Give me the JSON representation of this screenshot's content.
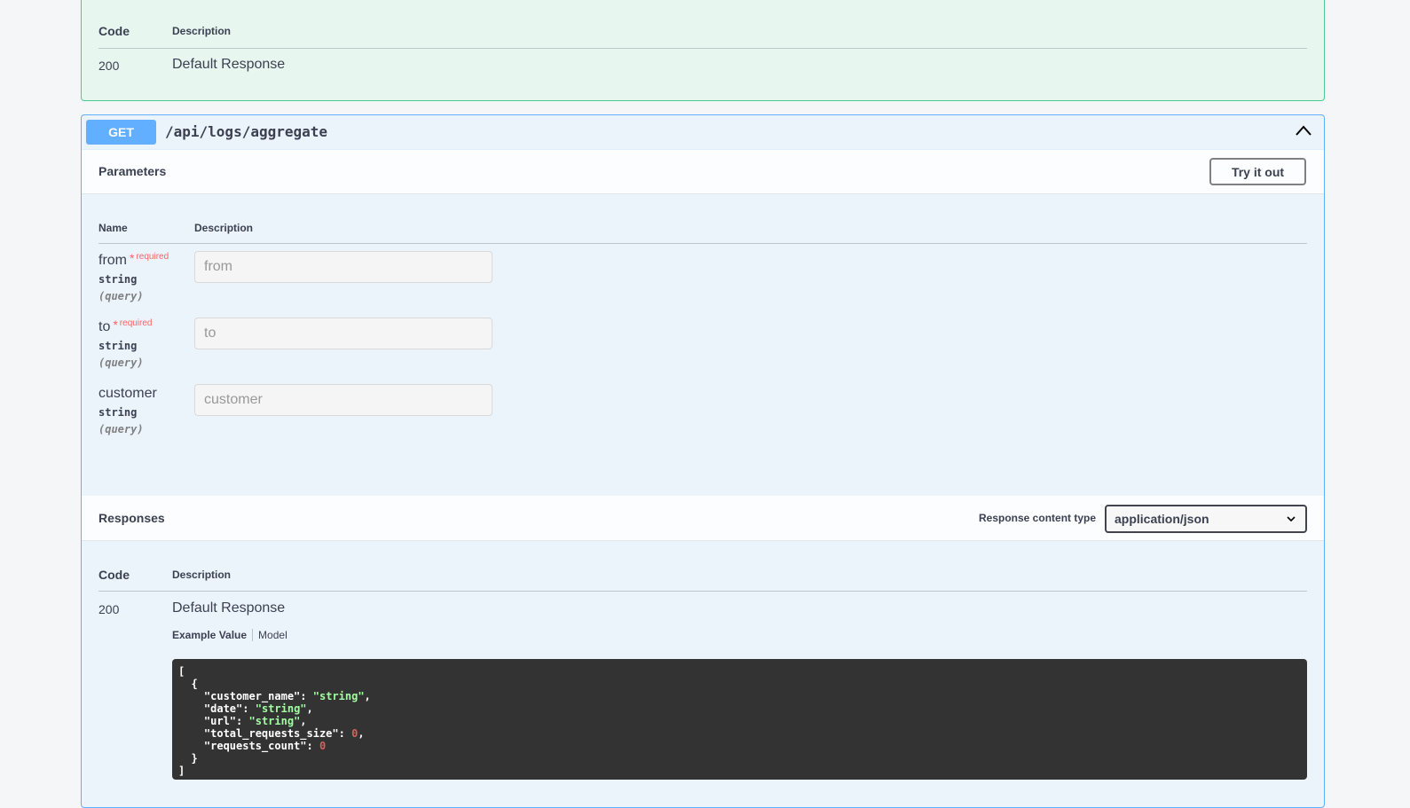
{
  "previous_operation": {
    "responses_header": {
      "code": "Code",
      "description": "Description"
    },
    "response_row": {
      "code": "200",
      "description": "Default Response"
    }
  },
  "operation": {
    "method": "GET",
    "path": "/api/logs/aggregate",
    "colors": {
      "method_bg": "#61affe",
      "block_bg": "#ebf3fb",
      "border": "#61affe"
    },
    "parameters": {
      "title": "Parameters",
      "try_it_out_label": "Try it out",
      "header": {
        "name": "Name",
        "description": "Description"
      },
      "items": [
        {
          "name": "from",
          "star": "*",
          "required": "required",
          "type": "string",
          "in": "(query)",
          "placeholder": "from",
          "value": ""
        },
        {
          "name": "to",
          "star": "*",
          "required": "required",
          "type": "string",
          "in": "(query)",
          "placeholder": "to",
          "value": ""
        },
        {
          "name": "customer",
          "type": "string",
          "in": "(query)",
          "placeholder": "customer",
          "value": ""
        }
      ]
    },
    "responses": {
      "title": "Responses",
      "content_type_label": "Response content type",
      "content_type_value": "application/json",
      "header": {
        "code": "Code",
        "description": "Description"
      },
      "row": {
        "code": "200",
        "description": "Default Response",
        "tab_example": "Example Value",
        "tab_model": "Model",
        "example_lines": [
          "[",
          "  {",
          "    \"customer_name\": \"string\",",
          "    \"date\": \"string\",",
          "    \"url\": \"string\",",
          "    \"total_requests_size\": 0,",
          "    \"requests_count\": 0",
          "  }",
          "]"
        ]
      }
    }
  },
  "icons": {
    "collapse": "chevron-up-icon",
    "select": "chevron-down-icon"
  }
}
